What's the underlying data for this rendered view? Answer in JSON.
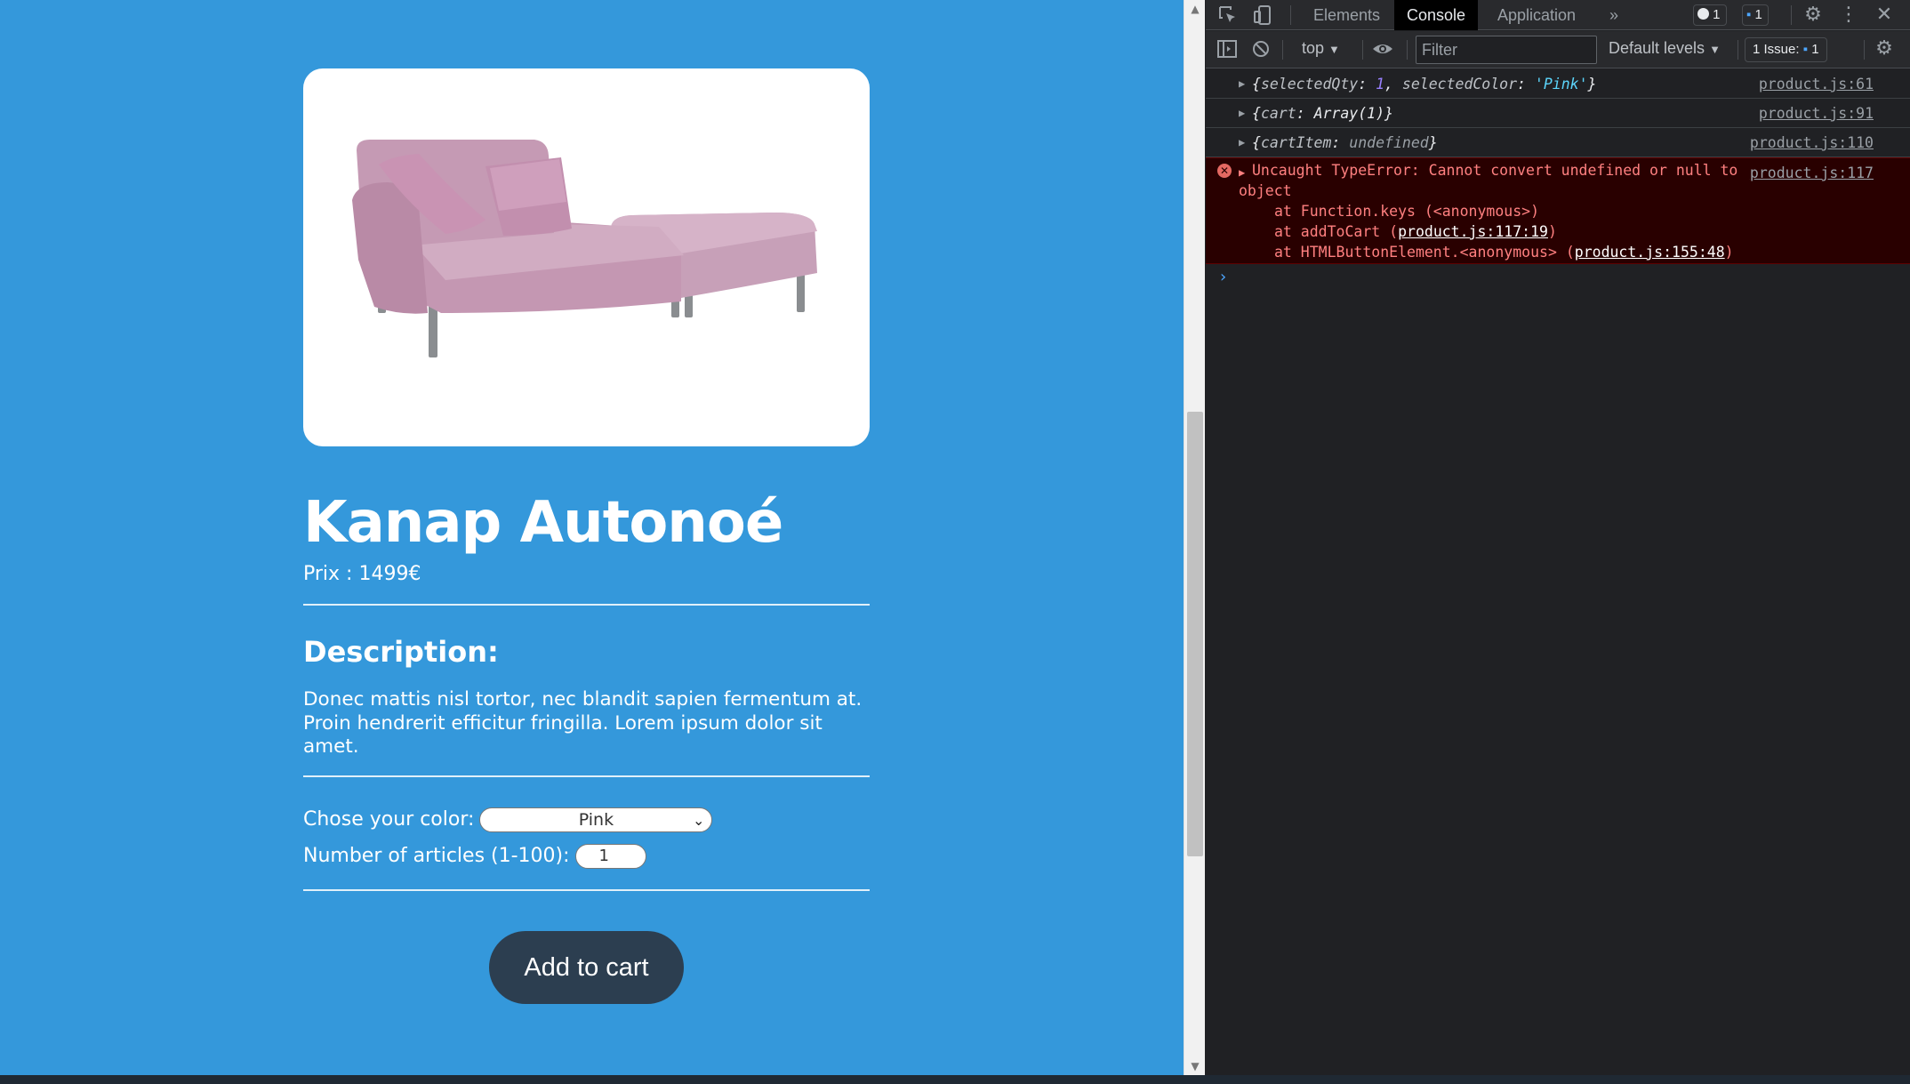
{
  "product": {
    "title": "Kanap Autonoé",
    "price_line": "Prix : 1499€",
    "description_heading": "Description:",
    "description": "Donec mattis nisl tortor, nec blandit sapien fermentum at. Proin hendrerit efficitur fringilla. Lorem ipsum dolor sit amet.",
    "color_label": "Chose your color:",
    "color_value": "Pink",
    "qty_label": "Number of articles (1-100):",
    "qty_value": "1",
    "add_to_cart": "Add to cart",
    "image_icon": "pink-sofa-image"
  },
  "colors": {
    "page_bg": "#3498db",
    "button_bg": "#2c3e50",
    "sofa": "#c99fb8",
    "devtools_bg": "#202124",
    "error_text": "#ff8080"
  },
  "devtools": {
    "tabs": [
      "Elements",
      "Console",
      "Application"
    ],
    "active_tab": "Console",
    "more_tabs": "»",
    "badge_errors": "1",
    "badge_messages": "1",
    "context": "top",
    "filter_placeholder": "Filter",
    "levels": "Default levels",
    "issues": "1 Issue:",
    "issues_count": "1",
    "logs": [
      {
        "source": "product.js:61"
      },
      {
        "source": "product.js:91"
      },
      {
        "source": "product.js:110"
      }
    ],
    "log1": {
      "k1": "selectedQty",
      "v1": "1",
      "k2": "selectedColor",
      "v2": "'Pink'"
    },
    "log2": {
      "k": "cart",
      "v": "Array(1)"
    },
    "log3": {
      "k": "cartItem",
      "v": "undefined"
    },
    "error": {
      "message_1": "Uncaught TypeError: Cannot convert undefined or null to",
      "message_2": "object",
      "stack_1_prefix": "at Function.keys (<anonymous>)",
      "stack_2_prefix": "at addToCart (",
      "stack_2_link": "product.js:117:19",
      "stack_3_prefix": "at HTMLButtonElement.<anonymous> (",
      "stack_3_link": "product.js:155:48",
      "close_paren": ")",
      "source": "product.js:117"
    },
    "prompt": "›"
  }
}
